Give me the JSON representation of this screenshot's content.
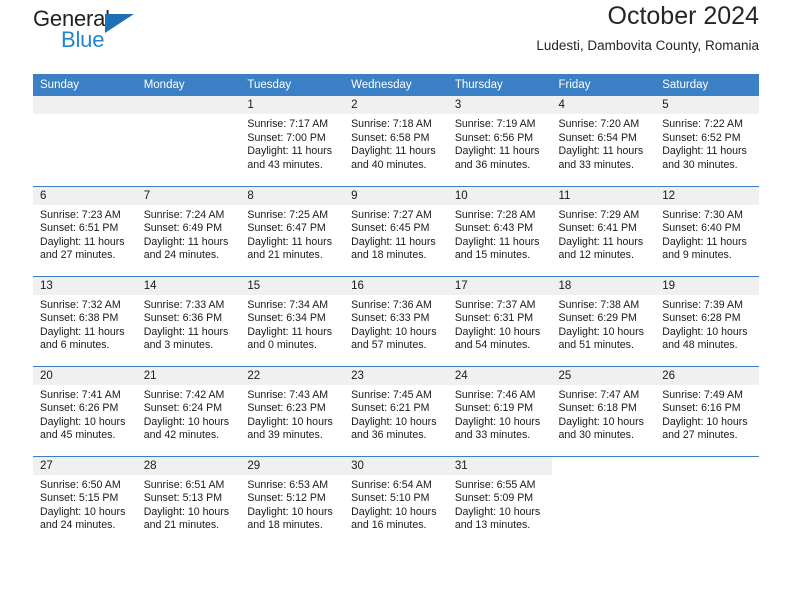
{
  "brand": {
    "name_top": "General",
    "name_bottom": "Blue",
    "triangle_icon": "triangle-icon",
    "color_top": "#231f20",
    "color_bottom": "#2287ce",
    "triangle_color": "#1f6fb5"
  },
  "header": {
    "title": "October 2024",
    "subtitle": "Ludesti, Dambovita County, Romania"
  },
  "colors": {
    "header_blue": "#3b7fc4",
    "daynum_band": "#f0f0f0",
    "text": "#1a1a1a"
  },
  "labels": {
    "sunrise_prefix": "Sunrise:",
    "sunset_prefix": "Sunset:",
    "daylight_prefix": "Daylight:"
  },
  "weekdays": [
    "Sunday",
    "Monday",
    "Tuesday",
    "Wednesday",
    "Thursday",
    "Friday",
    "Saturday"
  ],
  "weeks": [
    [
      {
        "day": "",
        "empty": true
      },
      {
        "day": "",
        "empty": true
      },
      {
        "day": "1",
        "sunrise": "Sunrise: 7:17 AM",
        "sunset": "Sunset: 7:00 PM",
        "daylight": "Daylight: 11 hours and 43 minutes."
      },
      {
        "day": "2",
        "sunrise": "Sunrise: 7:18 AM",
        "sunset": "Sunset: 6:58 PM",
        "daylight": "Daylight: 11 hours and 40 minutes."
      },
      {
        "day": "3",
        "sunrise": "Sunrise: 7:19 AM",
        "sunset": "Sunset: 6:56 PM",
        "daylight": "Daylight: 11 hours and 36 minutes."
      },
      {
        "day": "4",
        "sunrise": "Sunrise: 7:20 AM",
        "sunset": "Sunset: 6:54 PM",
        "daylight": "Daylight: 11 hours and 33 minutes."
      },
      {
        "day": "5",
        "sunrise": "Sunrise: 7:22 AM",
        "sunset": "Sunset: 6:52 PM",
        "daylight": "Daylight: 11 hours and 30 minutes."
      }
    ],
    [
      {
        "day": "6",
        "sunrise": "Sunrise: 7:23 AM",
        "sunset": "Sunset: 6:51 PM",
        "daylight": "Daylight: 11 hours and 27 minutes."
      },
      {
        "day": "7",
        "sunrise": "Sunrise: 7:24 AM",
        "sunset": "Sunset: 6:49 PM",
        "daylight": "Daylight: 11 hours and 24 minutes."
      },
      {
        "day": "8",
        "sunrise": "Sunrise: 7:25 AM",
        "sunset": "Sunset: 6:47 PM",
        "daylight": "Daylight: 11 hours and 21 minutes."
      },
      {
        "day": "9",
        "sunrise": "Sunrise: 7:27 AM",
        "sunset": "Sunset: 6:45 PM",
        "daylight": "Daylight: 11 hours and 18 minutes."
      },
      {
        "day": "10",
        "sunrise": "Sunrise: 7:28 AM",
        "sunset": "Sunset: 6:43 PM",
        "daylight": "Daylight: 11 hours and 15 minutes."
      },
      {
        "day": "11",
        "sunrise": "Sunrise: 7:29 AM",
        "sunset": "Sunset: 6:41 PM",
        "daylight": "Daylight: 11 hours and 12 minutes."
      },
      {
        "day": "12",
        "sunrise": "Sunrise: 7:30 AM",
        "sunset": "Sunset: 6:40 PM",
        "daylight": "Daylight: 11 hours and 9 minutes."
      }
    ],
    [
      {
        "day": "13",
        "sunrise": "Sunrise: 7:32 AM",
        "sunset": "Sunset: 6:38 PM",
        "daylight": "Daylight: 11 hours and 6 minutes."
      },
      {
        "day": "14",
        "sunrise": "Sunrise: 7:33 AM",
        "sunset": "Sunset: 6:36 PM",
        "daylight": "Daylight: 11 hours and 3 minutes."
      },
      {
        "day": "15",
        "sunrise": "Sunrise: 7:34 AM",
        "sunset": "Sunset: 6:34 PM",
        "daylight": "Daylight: 11 hours and 0 minutes."
      },
      {
        "day": "16",
        "sunrise": "Sunrise: 7:36 AM",
        "sunset": "Sunset: 6:33 PM",
        "daylight": "Daylight: 10 hours and 57 minutes."
      },
      {
        "day": "17",
        "sunrise": "Sunrise: 7:37 AM",
        "sunset": "Sunset: 6:31 PM",
        "daylight": "Daylight: 10 hours and 54 minutes."
      },
      {
        "day": "18",
        "sunrise": "Sunrise: 7:38 AM",
        "sunset": "Sunset: 6:29 PM",
        "daylight": "Daylight: 10 hours and 51 minutes."
      },
      {
        "day": "19",
        "sunrise": "Sunrise: 7:39 AM",
        "sunset": "Sunset: 6:28 PM",
        "daylight": "Daylight: 10 hours and 48 minutes."
      }
    ],
    [
      {
        "day": "20",
        "sunrise": "Sunrise: 7:41 AM",
        "sunset": "Sunset: 6:26 PM",
        "daylight": "Daylight: 10 hours and 45 minutes."
      },
      {
        "day": "21",
        "sunrise": "Sunrise: 7:42 AM",
        "sunset": "Sunset: 6:24 PM",
        "daylight": "Daylight: 10 hours and 42 minutes."
      },
      {
        "day": "22",
        "sunrise": "Sunrise: 7:43 AM",
        "sunset": "Sunset: 6:23 PM",
        "daylight": "Daylight: 10 hours and 39 minutes."
      },
      {
        "day": "23",
        "sunrise": "Sunrise: 7:45 AM",
        "sunset": "Sunset: 6:21 PM",
        "daylight": "Daylight: 10 hours and 36 minutes."
      },
      {
        "day": "24",
        "sunrise": "Sunrise: 7:46 AM",
        "sunset": "Sunset: 6:19 PM",
        "daylight": "Daylight: 10 hours and 33 minutes."
      },
      {
        "day": "25",
        "sunrise": "Sunrise: 7:47 AM",
        "sunset": "Sunset: 6:18 PM",
        "daylight": "Daylight: 10 hours and 30 minutes."
      },
      {
        "day": "26",
        "sunrise": "Sunrise: 7:49 AM",
        "sunset": "Sunset: 6:16 PM",
        "daylight": "Daylight: 10 hours and 27 minutes."
      }
    ],
    [
      {
        "day": "27",
        "sunrise": "Sunrise: 6:50 AM",
        "sunset": "Sunset: 5:15 PM",
        "daylight": "Daylight: 10 hours and 24 minutes."
      },
      {
        "day": "28",
        "sunrise": "Sunrise: 6:51 AM",
        "sunset": "Sunset: 5:13 PM",
        "daylight": "Daylight: 10 hours and 21 minutes."
      },
      {
        "day": "29",
        "sunrise": "Sunrise: 6:53 AM",
        "sunset": "Sunset: 5:12 PM",
        "daylight": "Daylight: 10 hours and 18 minutes."
      },
      {
        "day": "30",
        "sunrise": "Sunrise: 6:54 AM",
        "sunset": "Sunset: 5:10 PM",
        "daylight": "Daylight: 10 hours and 16 minutes."
      },
      {
        "day": "31",
        "sunrise": "Sunrise: 6:55 AM",
        "sunset": "Sunset: 5:09 PM",
        "daylight": "Daylight: 10 hours and 13 minutes."
      },
      {
        "day": "",
        "empty": true,
        "no_band": true
      },
      {
        "day": "",
        "empty": true,
        "no_band": true
      }
    ]
  ]
}
